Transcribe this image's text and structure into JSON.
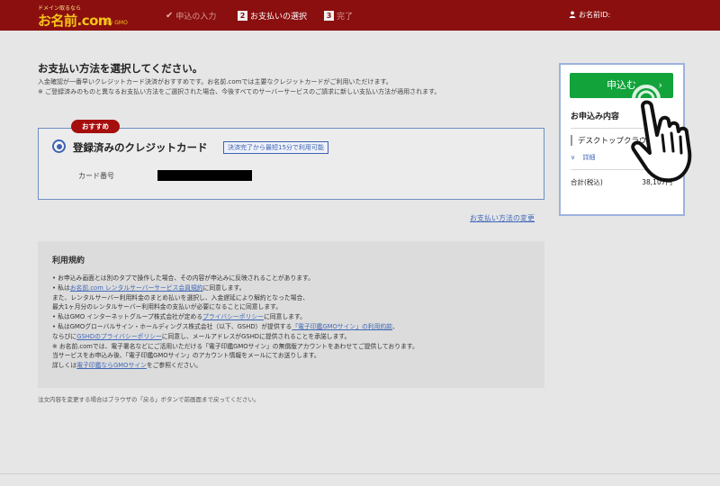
{
  "header": {
    "logo_tag": "ドメイン取るなら",
    "logo_main": "お名前.com",
    "logo_sub": "by GMO",
    "steps": [
      {
        "label": "申込の入力",
        "state": "done"
      },
      {
        "num": "2",
        "label": "お支払いの選択",
        "state": "current"
      },
      {
        "num": "3",
        "label": "完了",
        "state": "upcoming"
      }
    ],
    "user_label": "お名前ID:"
  },
  "main": {
    "title": "お支払い方法を選択してください。",
    "desc1": "入金確認が一番早いクレジットカード決済がおすすめです。お名前.comでは主要なクレジットカードがご利用いただけます。",
    "desc2": "※ ご登録済みのものと異なるお支払い方法をご選択された場合、今後すべてのサーバーサービスのご請求に新しい支払い方法が適用されます。",
    "payment": {
      "badge": "おすすめ",
      "title": "登録済みのクレジットカード",
      "note": "決済完了から最短15分で利用可能",
      "card_number_label": "カード番号"
    },
    "change_link": "お支払い方法の変更",
    "terms": {
      "title": "利用規約",
      "lines": [
        {
          "text": "• お申込み画面とは別のタブで操作した場合、その内容が申込みに反映されることがあります。"
        },
        {
          "pre": "• 私は",
          "link": "お名前.com レンタルサーバーサービス会員規約",
          "post": "に同意します。"
        },
        {
          "text": "   また、レンタルサーバー利用料金のまとめ払いを選択し、入金遅延により解約となった場合、"
        },
        {
          "text": "   最大1ヶ月分のレンタルサーバー利用料金の支払いが必要になることに同意します。"
        },
        {
          "pre": "• 私はGMO インターネットグループ株式会社が定める",
          "link": "プライバシーポリシー",
          "post": "に同意します。"
        },
        {
          "pre": "• 私はGMOグローバルサイン・ホールディングス株式会社（以下、GSHD）が提供する",
          "link": "「電子印鑑GMOサイン」の利用約款",
          "post": "、"
        },
        {
          "pre": "   ならびに",
          "link": "GSHDのプライバシーポリシー",
          "post": "に同意し、メールアドレスがGSHDに提供されることを承諾します。"
        },
        {
          "text": "※ お名前.comでは、電子署名などにご活用いただける「電子印鑑GMOサイン」の無償版アカウントをあわせてご提供しております。"
        },
        {
          "text": "   当サービスをお申込み後、「電子印鑑GMOサイン」のアカウント情報をメールにてお送りします。"
        },
        {
          "pre": "   詳しくは",
          "link": "電子印鑑ならGMOサイン",
          "post": "をご参照ください。"
        }
      ]
    },
    "footer_note": "注文内容を変更する場合はブラウザの「戻る」ボタンで前画面まで戻ってください。"
  },
  "sidebar": {
    "apply_label": "申込む",
    "apply_arrow": "›",
    "section_title": "お申込み内容",
    "item": "デスクトップクラウド",
    "detail_label": "詳細",
    "total_label": "合計(税込)",
    "total_value": "38,107円"
  },
  "colors": {
    "header_bg": "#8b0f0f",
    "logo": "#f5c518",
    "badge": "#a60d0d",
    "accent_blue": "#3e63b3",
    "apply_green": "#12a33b",
    "link": "#4169b8"
  },
  "icons": {
    "user": "user-icon",
    "check": "check-icon",
    "radio": "radio-selected-icon",
    "chevron": "chevron-down-icon",
    "cursor": "hand-pointer-icon"
  }
}
